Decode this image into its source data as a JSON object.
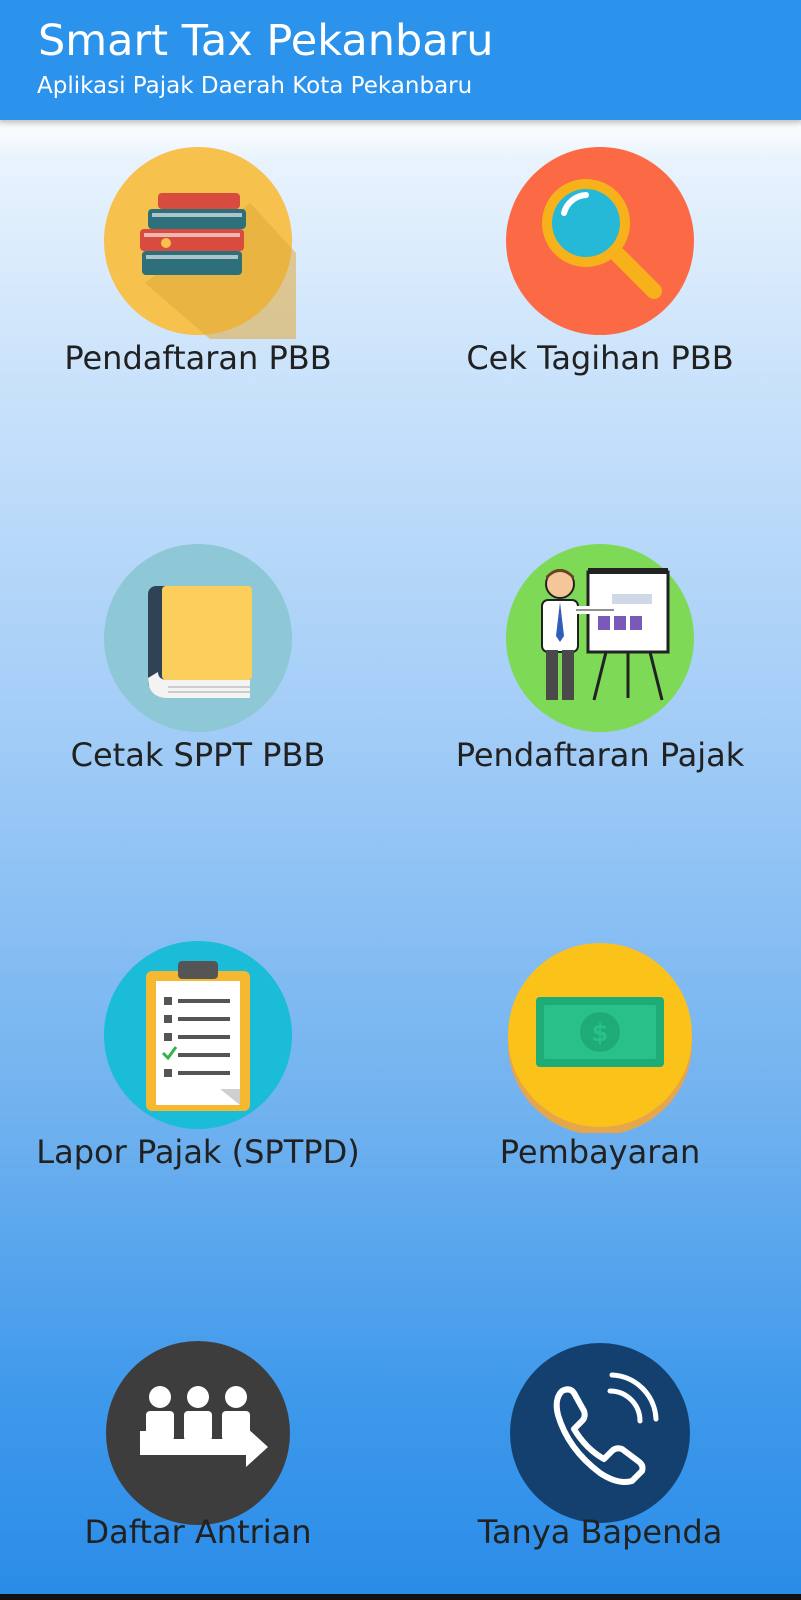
{
  "app_bar": {
    "title": "Smart Tax Pekanbaru",
    "subtitle": "Aplikasi Pajak Daerah Kota Pekanbaru",
    "color": "#2b93ec"
  },
  "menu": [
    {
      "label": "Pendaftaran PBB",
      "icon": "books-icon",
      "color": "#f6c14d"
    },
    {
      "label": "Cek Tagihan PBB",
      "icon": "magnifier-icon",
      "color": "#fb6a44"
    },
    {
      "label": "Cetak SPPT PBB",
      "icon": "book-icon",
      "color": "#8ec8d6"
    },
    {
      "label": "Pendaftaran Pajak",
      "icon": "presentation-icon",
      "color": "#7ed957"
    },
    {
      "label": "Lapor Pajak (SPTPD)",
      "icon": "clipboard-icon",
      "color": "#1bbcd8"
    },
    {
      "label": "Pembayaran",
      "icon": "money-icon",
      "color": "#fbc21a"
    },
    {
      "label": "Daftar Antrian",
      "icon": "queue-icon",
      "color": "#3d3d3d"
    },
    {
      "label": "Tanya Bapenda",
      "icon": "phone-icon",
      "color": "#13406f"
    }
  ]
}
